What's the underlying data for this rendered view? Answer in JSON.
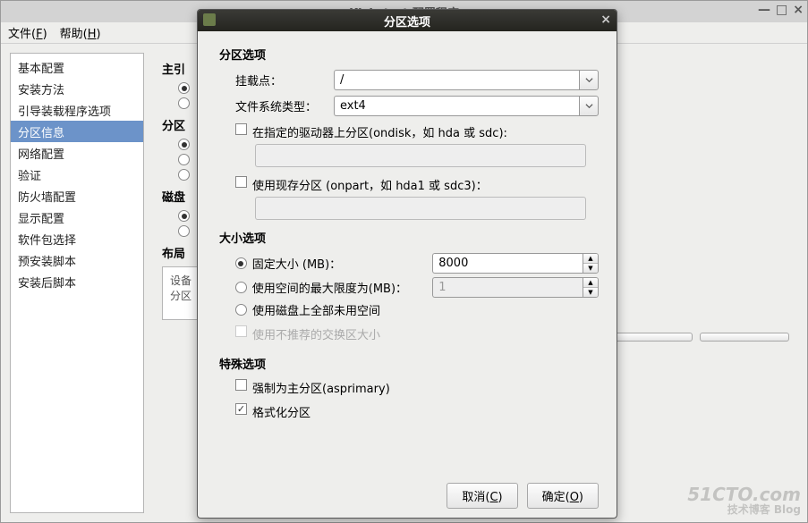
{
  "mainwin": {
    "title": "Kickstart 配置程序",
    "menu": {
      "file": "文件(F)",
      "help": "帮助(H)"
    },
    "sidebar_items": [
      "基本配置",
      "安装方法",
      "引导装载程序选项",
      "分区信息",
      "网络配置",
      "验证",
      "防火墙配置",
      "显示配置",
      "软件包选择",
      "预安装脚本",
      "安装后脚本"
    ],
    "sidebar_selected_index": 3,
    "content": {
      "sect1": "主引",
      "sect2": "分区",
      "sect3": "磁盘",
      "sect4": "布局",
      "table_hdr1": "设备",
      "table_hdr2": "分区"
    }
  },
  "dialog": {
    "title": "分区选项",
    "group_partition": "分区选项",
    "mount_label": "挂载点：",
    "mount_value": "/",
    "fs_label": "文件系统类型：",
    "fs_value": "ext4",
    "chk_ondisk": "在指定的驱动器上分区(ondisk，如 hda 或 sdc):",
    "chk_onpart": "使用现存分区 (onpart，如 hda1 或 sdc3)：",
    "group_size": "大小选项",
    "radio_fixed": "固定大小 (MB)：",
    "fixed_value": "8000",
    "radio_max": "使用空间的最大限度为(MB)：",
    "max_value": "1",
    "radio_fill": "使用磁盘上全部未用空间",
    "chk_swap": "使用不推荐的交换区大小",
    "group_special": "特殊选项",
    "chk_asprimary": "强制为主分区(asprimary)",
    "chk_format": "格式化分区",
    "btn_cancel": "取消(C)",
    "btn_ok": "确定(O)"
  },
  "watermark": {
    "l1": "51CTO.com",
    "l2": "技术博客  Blog"
  }
}
